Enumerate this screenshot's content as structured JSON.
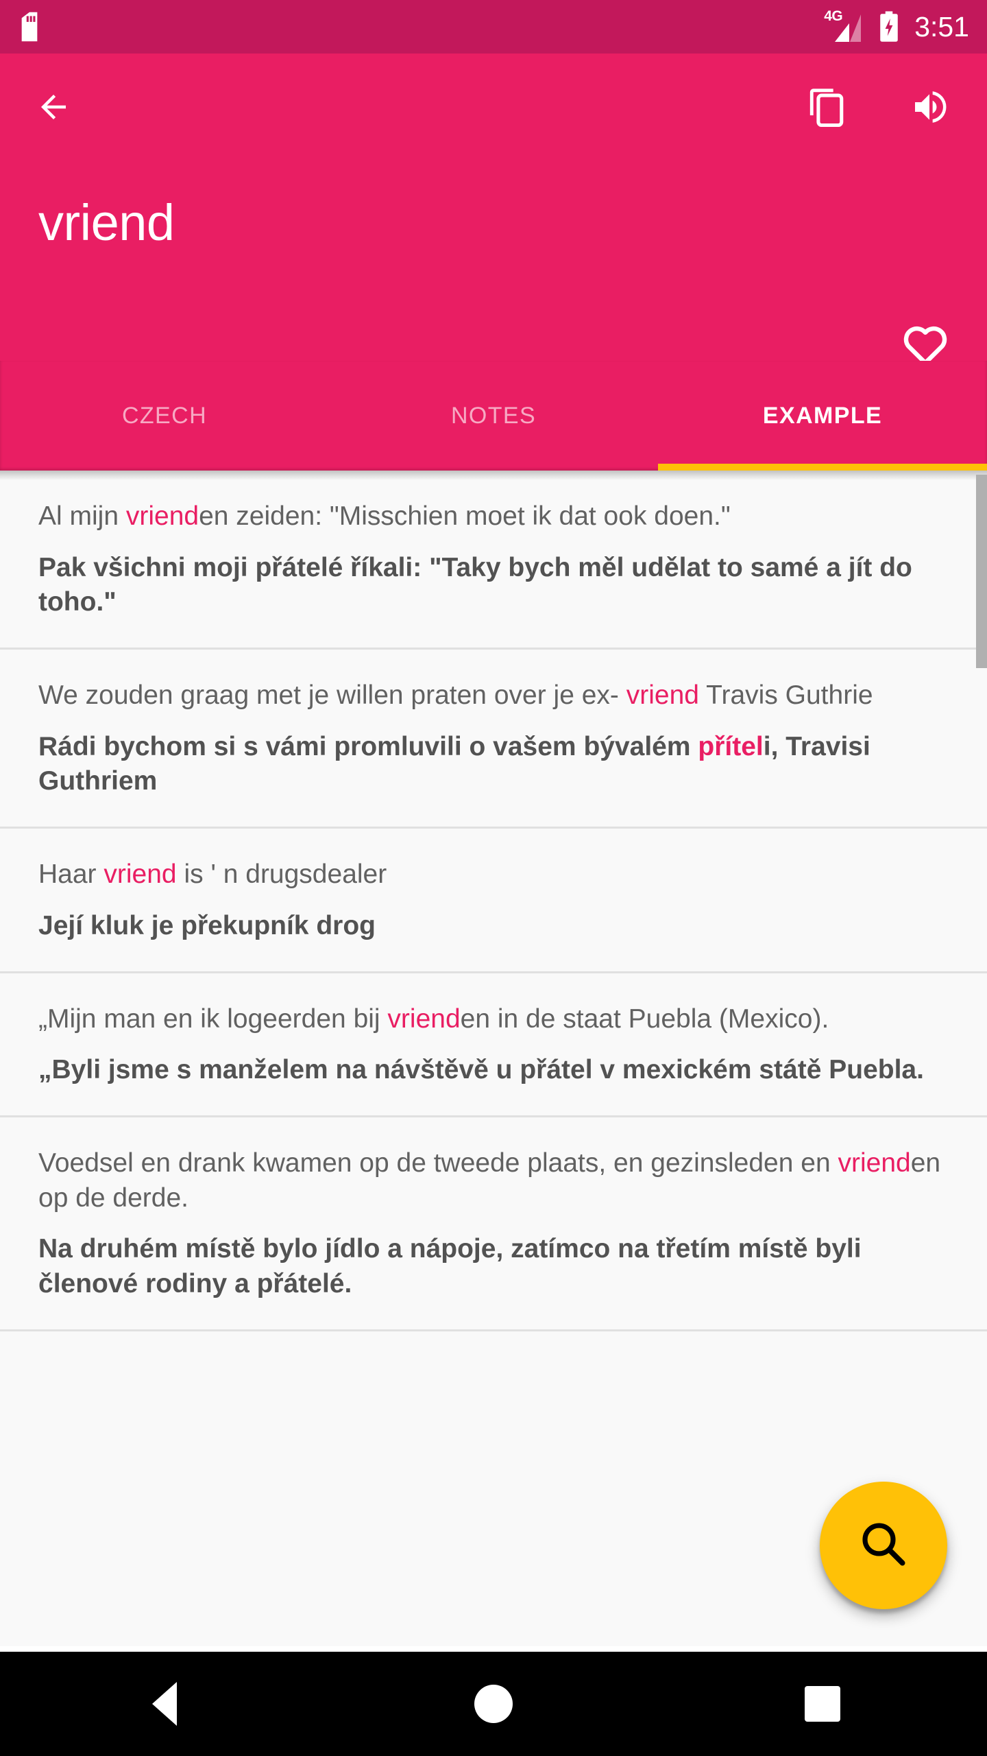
{
  "status_bar": {
    "sim_icon": "sim-card-icon",
    "network_label": "4G",
    "signal_icon": "signal-bars-icon",
    "battery_icon": "battery-charging-icon",
    "time": "3:51",
    "background_color": "#c2185b"
  },
  "app_bar": {
    "background_color": "#e91e63",
    "back_icon": "arrow-back-icon",
    "copy_icon": "copy-icon",
    "speaker_icon": "volume-up-icon",
    "favorite_icon": "heart-outline-icon",
    "title": "vriend"
  },
  "tabs": {
    "indicator_color": "#ffc107",
    "items": [
      {
        "label": "CZECH",
        "active": false
      },
      {
        "label": "NOTES",
        "active": false
      },
      {
        "label": "EXAMPLE",
        "active": true
      }
    ]
  },
  "examples": [
    {
      "source": [
        {
          "text": "Al mijn ",
          "highlight": false
        },
        {
          "text": "vriend",
          "highlight": true
        },
        {
          "text": "en zeiden: \"Misschien moet ik dat ook doen.\"",
          "highlight": false
        }
      ],
      "target": [
        {
          "text": "Pak všichni moji přátelé říkali: \"Taky bych měl udělat to samé a jít do toho.\"",
          "highlight": false
        }
      ]
    },
    {
      "source": [
        {
          "text": "We zouden graag met je willen praten over je ex- ",
          "highlight": false
        },
        {
          "text": "vriend",
          "highlight": true
        },
        {
          "text": " Travis Guthrie",
          "highlight": false
        }
      ],
      "target": [
        {
          "text": "Rádi bychom si s vámi promluvili o vašem bývalém ",
          "highlight": false
        },
        {
          "text": "přítel",
          "highlight": true
        },
        {
          "text": "i, Travisi Guthriem",
          "highlight": false
        }
      ]
    },
    {
      "source": [
        {
          "text": "Haar ",
          "highlight": false
        },
        {
          "text": "vriend",
          "highlight": true
        },
        {
          "text": " is ' n drugsdealer",
          "highlight": false
        }
      ],
      "target": [
        {
          "text": "Její kluk je překupník drog",
          "highlight": false
        }
      ]
    },
    {
      "source": [
        {
          "text": "„Mijn man en ik logeerden bij ",
          "highlight": false
        },
        {
          "text": "vriend",
          "highlight": true
        },
        {
          "text": "en in de staat Puebla (Mexico).",
          "highlight": false
        }
      ],
      "target": [
        {
          "text": "„Byli jsme s manželem na návštěvě u přátel v mexickém státě Puebla.",
          "highlight": false
        }
      ]
    },
    {
      "source": [
        {
          "text": "Voedsel en drank kwamen op de tweede plaats, en gezinsleden en ",
          "highlight": false
        },
        {
          "text": "vriend",
          "highlight": true
        },
        {
          "text": "en op de derde.",
          "highlight": false
        }
      ],
      "target": [
        {
          "text": "Na druhém místě bylo jídlo a nápoje, zatímco na třetím místě byli členové rodiny a přátelé.",
          "highlight": false
        }
      ]
    }
  ],
  "fab": {
    "icon": "search-icon",
    "background_color": "#ffc107",
    "icon_color": "#000000"
  },
  "nav_bar": {
    "background_color": "#000000",
    "items": [
      {
        "icon": "back-triangle-icon"
      },
      {
        "icon": "home-circle-icon"
      },
      {
        "icon": "recents-square-icon"
      }
    ]
  },
  "colors": {
    "accent_pink": "#e91e63",
    "status_pink": "#c2185b",
    "accent_yellow": "#ffc107",
    "list_background": "#f9f9f9",
    "divider": "#e0e0e0"
  }
}
